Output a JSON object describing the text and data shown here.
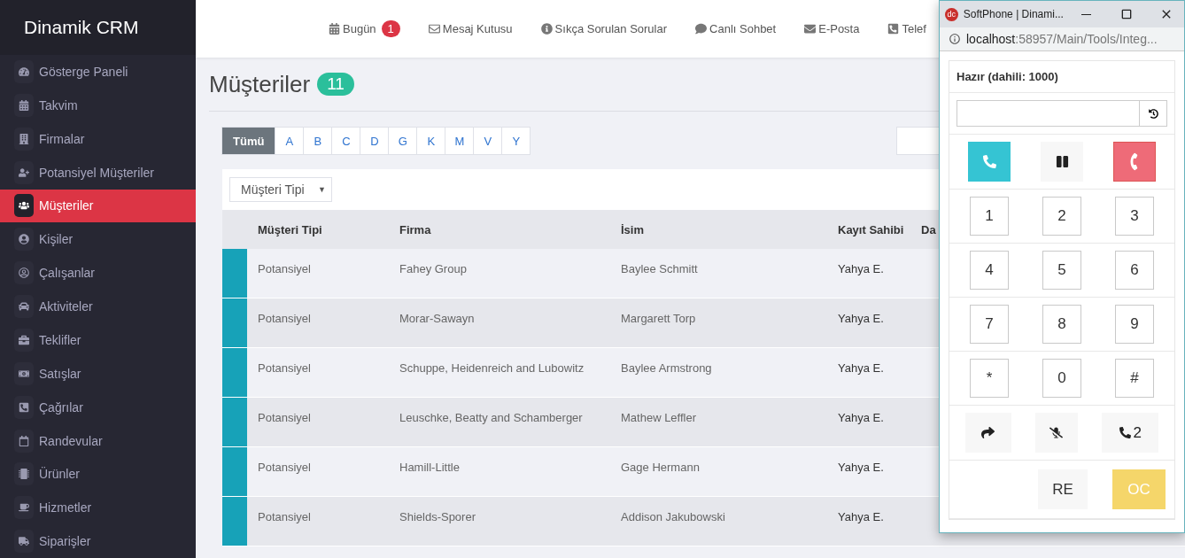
{
  "sidebar": {
    "brand": "Dinamik CRM",
    "items": [
      {
        "label": "Gösterge Paneli",
        "selected": false
      },
      {
        "label": "Takvim",
        "selected": false
      },
      {
        "label": "Firmalar",
        "selected": false
      },
      {
        "label": "Potansiyel Müşteriler",
        "selected": false
      },
      {
        "label": "Müşteriler",
        "selected": true
      },
      {
        "label": "Kişiler",
        "selected": false
      },
      {
        "label": "Çalışanlar",
        "selected": false
      },
      {
        "label": "Aktiviteler",
        "selected": false
      },
      {
        "label": "Teklifler",
        "selected": false
      },
      {
        "label": "Satışlar",
        "selected": false
      },
      {
        "label": "Çağrılar",
        "selected": false
      },
      {
        "label": "Randevular",
        "selected": false
      },
      {
        "label": "Ürünler",
        "selected": false
      },
      {
        "label": "Hizmetler",
        "selected": false
      },
      {
        "label": "Siparişler",
        "selected": false
      }
    ]
  },
  "topbar": {
    "links": [
      {
        "label": "Bugün",
        "badge": "1"
      },
      {
        "label": "Mesaj Kutusu"
      },
      {
        "label": "Sıkça Sorulan Sorular"
      },
      {
        "label": "Canlı Sohbet"
      },
      {
        "label": "E-Posta"
      },
      {
        "label": "Telef"
      }
    ]
  },
  "page": {
    "title": "Müşteriler",
    "count": "11"
  },
  "letter_filter": [
    {
      "label": "Tümü",
      "selected": true
    },
    {
      "label": "A",
      "selected": false
    },
    {
      "label": "B",
      "selected": false
    },
    {
      "label": "C",
      "selected": false
    },
    {
      "label": "D",
      "selected": false
    },
    {
      "label": "G",
      "selected": false
    },
    {
      "label": "K",
      "selected": false
    },
    {
      "label": "M",
      "selected": false
    },
    {
      "label": "V",
      "selected": false
    },
    {
      "label": "Y",
      "selected": false
    }
  ],
  "type_filter": {
    "value": "Müşteri Tipi",
    "caret": "▼"
  },
  "table": {
    "columns": [
      "Müşteri Tipi",
      "Firma",
      "İsim",
      "Kayıt Sahibi",
      "Da"
    ],
    "rows": [
      {
        "cells": [
          "Potansiyel",
          "Fahey Group",
          "Baylee Schmitt",
          "Yahya E."
        ]
      },
      {
        "cells": [
          "Potansiyel",
          "Morar-Sawayn",
          "Margarett Torp",
          "Yahya E."
        ]
      },
      {
        "cells": [
          "Potansiyel",
          "Schuppe, Heidenreich and Lubowitz",
          "Baylee Armstrong",
          "Yahya E."
        ]
      },
      {
        "cells": [
          "Potansiyel",
          "Leuschke, Beatty and Schamberger",
          "Mathew Leffler",
          "Yahya E."
        ]
      },
      {
        "cells": [
          "Potansiyel",
          "Hamill-Little",
          "Gage Hermann",
          "Yahya E."
        ]
      },
      {
        "cells": [
          "Potansiyel",
          "Shields-Sporer",
          "Addison Jakubowski",
          "Yahya E."
        ]
      }
    ]
  },
  "softphone": {
    "title": "SoftPhone | Dinami...",
    "logo": "dc",
    "url_host": "localhost",
    "url_path": ":58957/Main/Tools/Integ...",
    "status": "Hazır (dahili: 1000)",
    "keys": [
      "1",
      "2",
      "3",
      "4",
      "5",
      "6",
      "7",
      "8",
      "9",
      "*",
      "0",
      "#"
    ],
    "line_label": "2",
    "buttons": [
      "RE",
      "OC"
    ]
  }
}
